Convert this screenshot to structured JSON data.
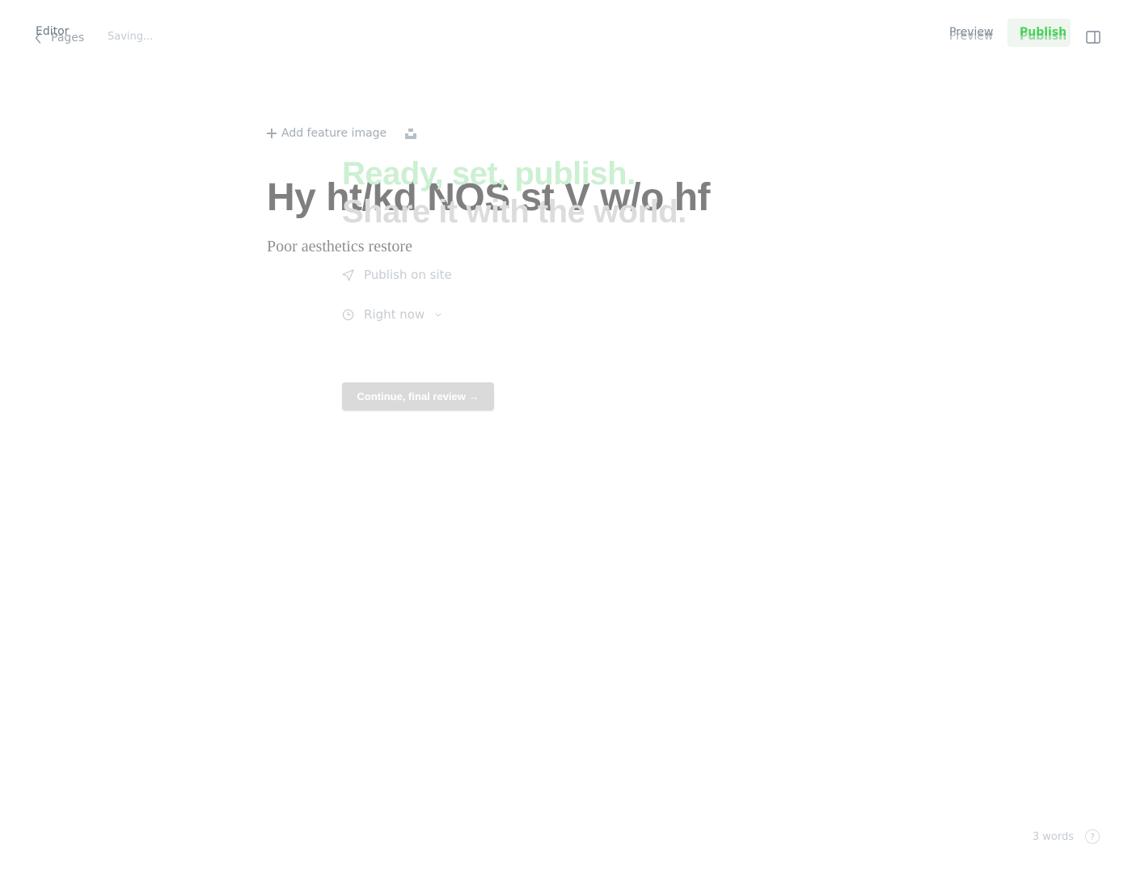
{
  "editor": {
    "back_label": "Pages",
    "status": "Saving...",
    "preview_label": "Preview",
    "publish_label": "Publish",
    "feature_image_label": "Add feature image",
    "post_title": "Hy ht/kd NOS st V w/o hf",
    "excerpt": "Poor aesthetics restore",
    "word_count": "3 words",
    "help_symbol": "?"
  },
  "publish_flow": {
    "back_label": "Editor",
    "preview_label": "Preview",
    "publish_label": "Publish",
    "heading_line1": "Ready, set, publish.",
    "heading_line2": "Share it with the world.",
    "option_publish_on": "Publish on site",
    "option_time": "Right now",
    "continue_label": "Continue, final review →"
  },
  "colors": {
    "accent_green": "#30cf43",
    "title_grey": "#7f7f7f"
  }
}
